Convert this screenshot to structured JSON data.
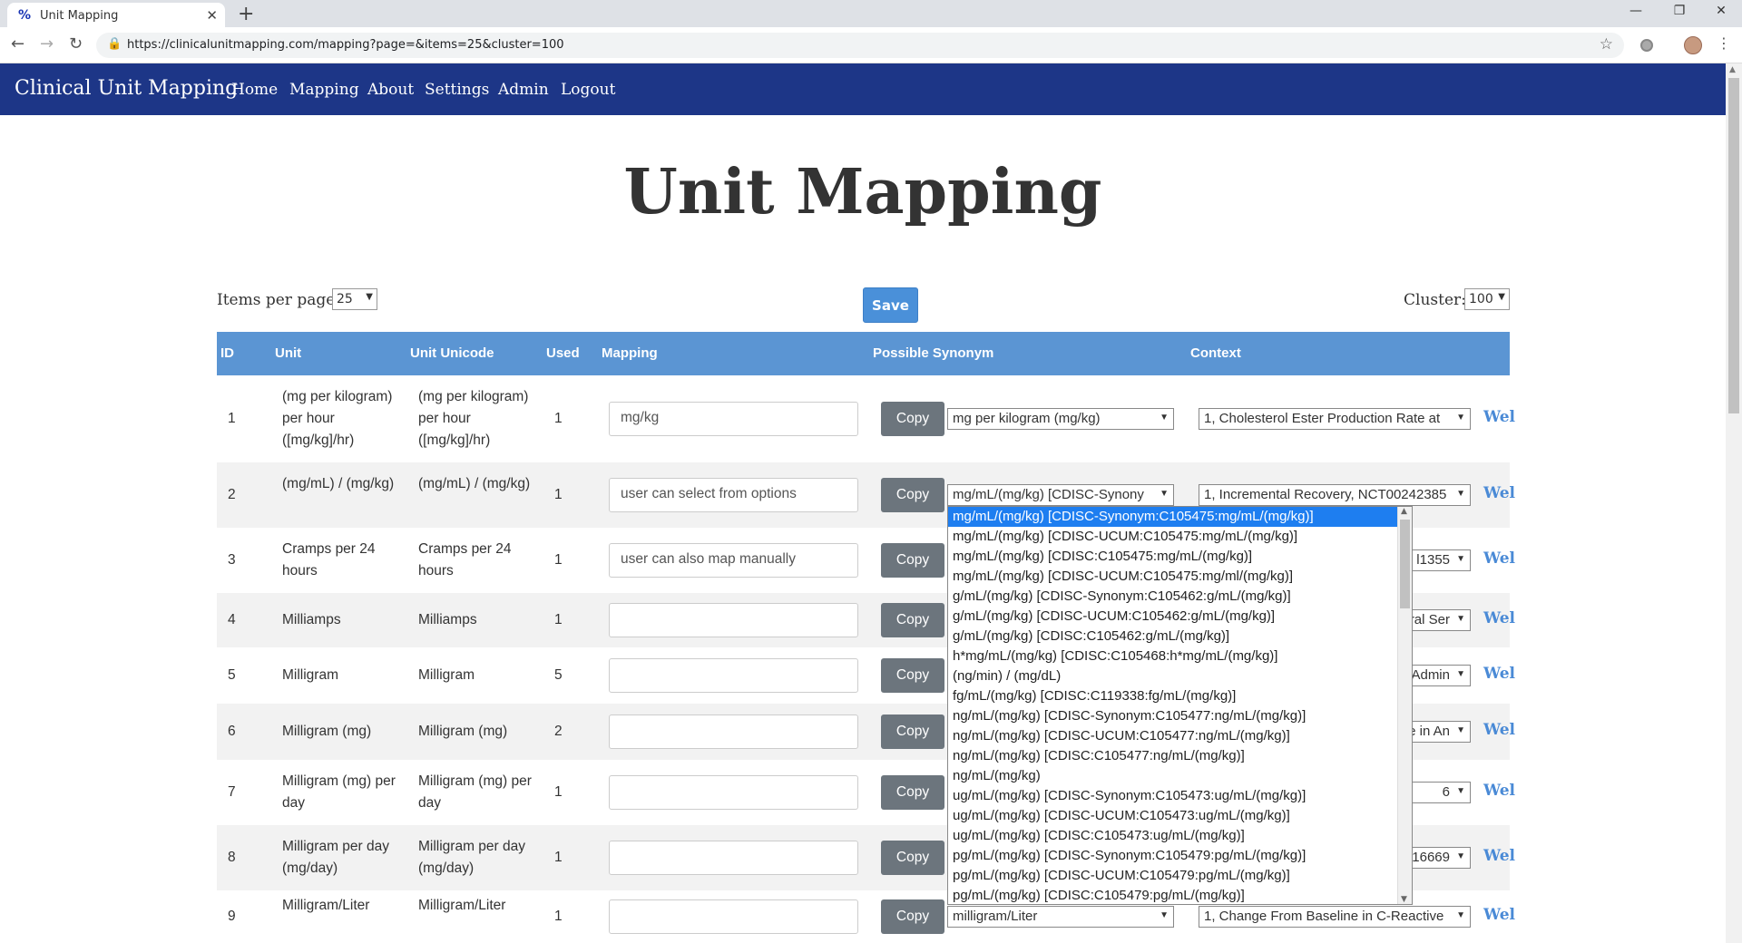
{
  "browser": {
    "tab_title": "Unit Mapping",
    "tab_favicon": "%",
    "url": "https://clinicalunitmapping.com/mapping?page=&items=25&cluster=100"
  },
  "nav": {
    "brand": "Clinical Unit Mapping",
    "links": [
      "Home",
      "Mapping",
      "About",
      "Settings",
      "Admin",
      "Logout"
    ]
  },
  "page": {
    "title": "Unit Mapping",
    "items_per_page_label": "Items per page:",
    "items_per_page_value": "25",
    "save_label": "Save",
    "cluster_label": "Cluster:",
    "cluster_value": "100"
  },
  "table": {
    "headers": [
      "ID",
      "Unit",
      "Unit Unicode",
      "Used",
      "Mapping",
      "Possible Synonym",
      "Context"
    ],
    "copy_label": "Copy",
    "web_label": "Wel",
    "rows": [
      {
        "id": "1",
        "unit": "(mg per kilogram) per hour ([mg/kg]/hr)",
        "unicode": "(mg per kilogram) per hour ([mg/kg]/hr)",
        "used": "1",
        "mapping": "mg/kg",
        "synonym": "mg per kilogram (mg/kg)",
        "context": "1, Cholesterol Ester Production Rate at"
      },
      {
        "id": "2",
        "unit": "(mg/mL) / (mg/kg)",
        "unicode": "(mg/mL) / (mg/kg)",
        "used": "1",
        "mapping": "user can select from options",
        "synonym": "mg/mL/(mg/kg) [CDISC-Synony",
        "context": "1, Incremental Recovery, NCT00242385"
      },
      {
        "id": "3",
        "unit": "Cramps per 24 hours",
        "unicode": "Cramps per 24 hours",
        "used": "1",
        "mapping": "user can also map manually",
        "synonym": "",
        "context": "l1355"
      },
      {
        "id": "4",
        "unit": "Milliamps",
        "unicode": "Milliamps",
        "used": "1",
        "mapping": "",
        "synonym": "",
        "context": "ral Ser"
      },
      {
        "id": "5",
        "unit": "Milligram",
        "unicode": "Milligram",
        "used": "5",
        "mapping": "",
        "synonym": "",
        "context": "Admin"
      },
      {
        "id": "6",
        "unit": "Milligram (mg)",
        "unicode": "Milligram (mg)",
        "used": "2",
        "mapping": "",
        "synonym": "",
        "context": "e in An"
      },
      {
        "id": "7",
        "unit": "Milligram (mg) per day",
        "unicode": "Milligram (mg) per day",
        "used": "1",
        "mapping": "",
        "synonym": "",
        "context": "6"
      },
      {
        "id": "8",
        "unit": "Milligram per day (mg/day)",
        "unicode": "Milligram per day (mg/day)",
        "used": "1",
        "mapping": "",
        "synonym": "",
        "context": "16669"
      },
      {
        "id": "9",
        "unit": "Milligram/Liter",
        "unicode": "Milligram/Liter",
        "used": "1",
        "mapping": "",
        "synonym": "milligram/Liter",
        "context": "1, Change From Baseline in C-Reactive"
      }
    ]
  },
  "dropdown": {
    "options": [
      "mg/mL/(mg/kg) [CDISC-Synonym:C105475:mg/mL/(mg/kg)]",
      "mg/mL/(mg/kg) [CDISC-UCUM:C105475:mg/mL/(mg/kg)]",
      "mg/mL/(mg/kg) [CDISC:C105475:mg/mL/(mg/kg)]",
      "mg/mL/(mg/kg) [CDISC-UCUM:C105475:mg/ml/(mg/kg)]",
      "g/mL/(mg/kg) [CDISC-Synonym:C105462:g/mL/(mg/kg)]",
      "g/mL/(mg/kg) [CDISC-UCUM:C105462:g/mL/(mg/kg)]",
      "g/mL/(mg/kg) [CDISC:C105462:g/mL/(mg/kg)]",
      "h*mg/mL/(mg/kg) [CDISC:C105468:h*mg/mL/(mg/kg)]",
      "(ng/min) / (mg/dL)",
      "fg/mL/(mg/kg) [CDISC:C119338:fg/mL/(mg/kg)]",
      "ng/mL/(mg/kg) [CDISC-Synonym:C105477:ng/mL/(mg/kg)]",
      "ng/mL/(mg/kg) [CDISC-UCUM:C105477:ng/mL/(mg/kg)]",
      "ng/mL/(mg/kg) [CDISC:C105477:ng/mL/(mg/kg)]",
      "ng/mL/(mg/kg)",
      "ug/mL/(mg/kg) [CDISC-Synonym:C105473:ug/mL/(mg/kg)]",
      "ug/mL/(mg/kg) [CDISC-UCUM:C105473:ug/mL/(mg/kg)]",
      "ug/mL/(mg/kg) [CDISC:C105473:ug/mL/(mg/kg)]",
      "pg/mL/(mg/kg) [CDISC-Synonym:C105479:pg/mL/(mg/kg)]",
      "pg/mL/(mg/kg) [CDISC-UCUM:C105479:pg/mL/(mg/kg)]",
      "pg/mL/(mg/kg) [CDISC:C105479:pg/mL/(mg/kg)]"
    ],
    "selected_index": 0
  },
  "colors": {
    "navbar": "#1d3687",
    "table_header": "#5b95d3",
    "save_button": "#4a90d9",
    "copy_button": "#6c757d",
    "dropdown_selected": "#1e7ef0",
    "link": "#4a8ad6"
  }
}
